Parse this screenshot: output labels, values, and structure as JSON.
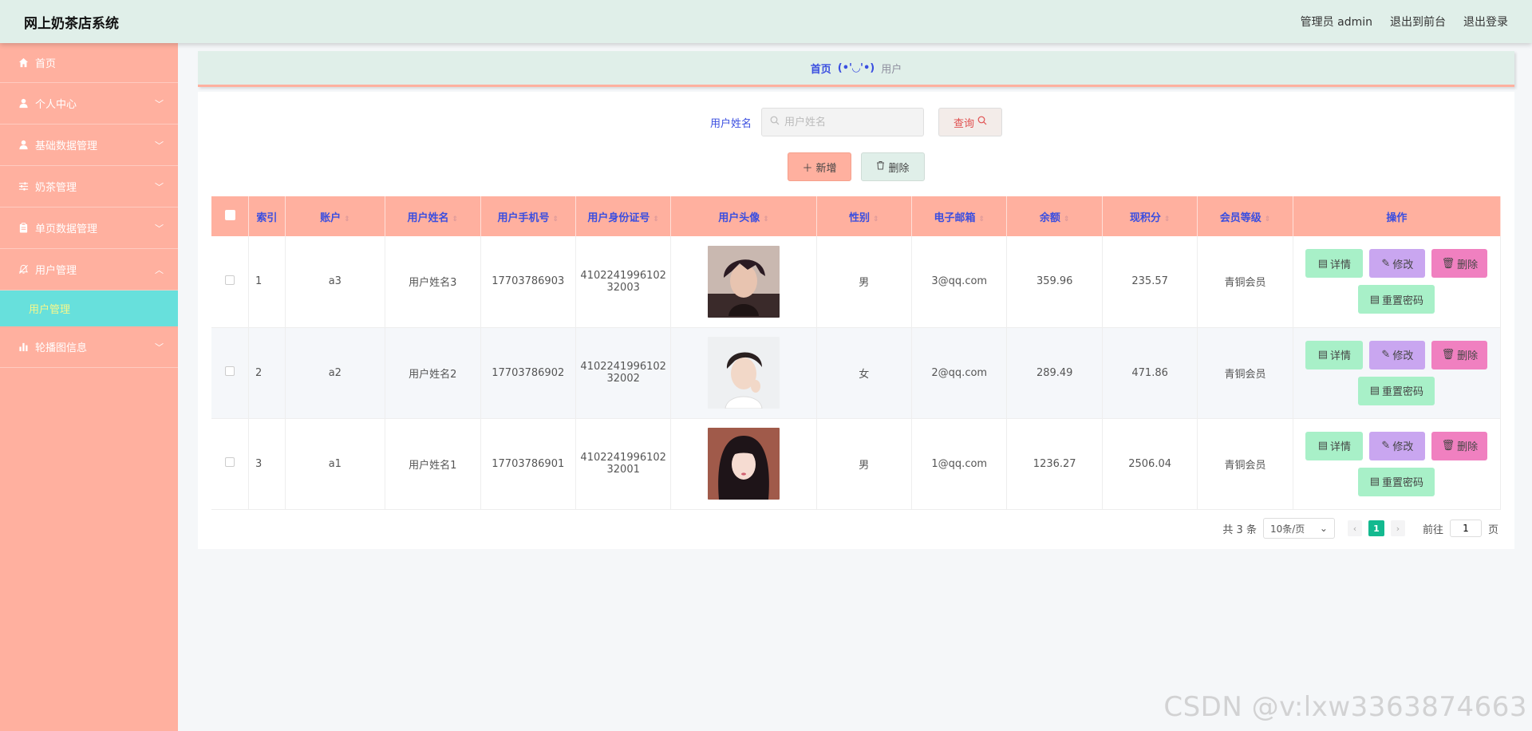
{
  "header": {
    "title": "网上奶茶店系统",
    "admin_label": "管理员 admin",
    "exit_front": "退出到前台",
    "logout": "退出登录"
  },
  "sidebar": {
    "items": [
      {
        "label": "首页",
        "icon": "home-icon"
      },
      {
        "label": "个人中心",
        "icon": "user-icon"
      },
      {
        "label": "基础数据管理",
        "icon": "user-icon"
      },
      {
        "label": "奶茶管理",
        "icon": "sliders-icon"
      },
      {
        "label": "单页数据管理",
        "icon": "clipboard-icon"
      },
      {
        "label": "用户管理",
        "icon": "bell-off-icon"
      },
      {
        "label": "轮播图信息",
        "icon": "bar-chart-icon"
      }
    ],
    "active_sub": "用户管理"
  },
  "breadcrumb": {
    "home": "首页",
    "face": "(•'◡'•)",
    "current": "用户"
  },
  "search": {
    "label": "用户姓名",
    "placeholder": "用户姓名",
    "query_button": "查询"
  },
  "actions": {
    "add": "新增",
    "delete": "删除"
  },
  "table": {
    "columns": [
      "索引",
      "账户",
      "用户姓名",
      "用户手机号",
      "用户身份证号",
      "用户头像",
      "性别",
      "电子邮箱",
      "余额",
      "现积分",
      "会员等级",
      "操作"
    ],
    "rows": [
      {
        "index": "1",
        "account": "a3",
        "name": "用户姓名3",
        "phone": "17703786903",
        "id_line1": "4102241996102",
        "id_line2": "32003",
        "gender": "男",
        "email": "3@qq.com",
        "balance": "359.96",
        "points": "235.57",
        "level": "青铜会员"
      },
      {
        "index": "2",
        "account": "a2",
        "name": "用户姓名2",
        "phone": "17703786902",
        "id_line1": "4102241996102",
        "id_line2": "32002",
        "gender": "女",
        "email": "2@qq.com",
        "balance": "289.49",
        "points": "471.86",
        "level": "青铜会员"
      },
      {
        "index": "3",
        "account": "a1",
        "name": "用户姓名1",
        "phone": "17703786901",
        "id_line1": "4102241996102",
        "id_line2": "32001",
        "gender": "男",
        "email": "1@qq.com",
        "balance": "1236.27",
        "points": "2506.04",
        "level": "青铜会员"
      }
    ],
    "ops": {
      "detail": "详情",
      "edit": "修改",
      "delete": "删除",
      "reset": "重置密码"
    }
  },
  "pagination": {
    "total": "共 3 条",
    "page_size": "10条/页",
    "current_page": "1",
    "goto_prefix": "前往",
    "goto_value": "1",
    "goto_suffix": "页"
  },
  "watermark": "CSDN @v:lxw3363874663",
  "colors": {
    "header_bg": "#e0efe9",
    "sidebar_bg": "#ffb09f",
    "sub_active_bg": "#67e0dc",
    "table_header_bg": "#ffb09f",
    "accent_text": "#3a4ee0",
    "page_active": "#13b98f"
  }
}
